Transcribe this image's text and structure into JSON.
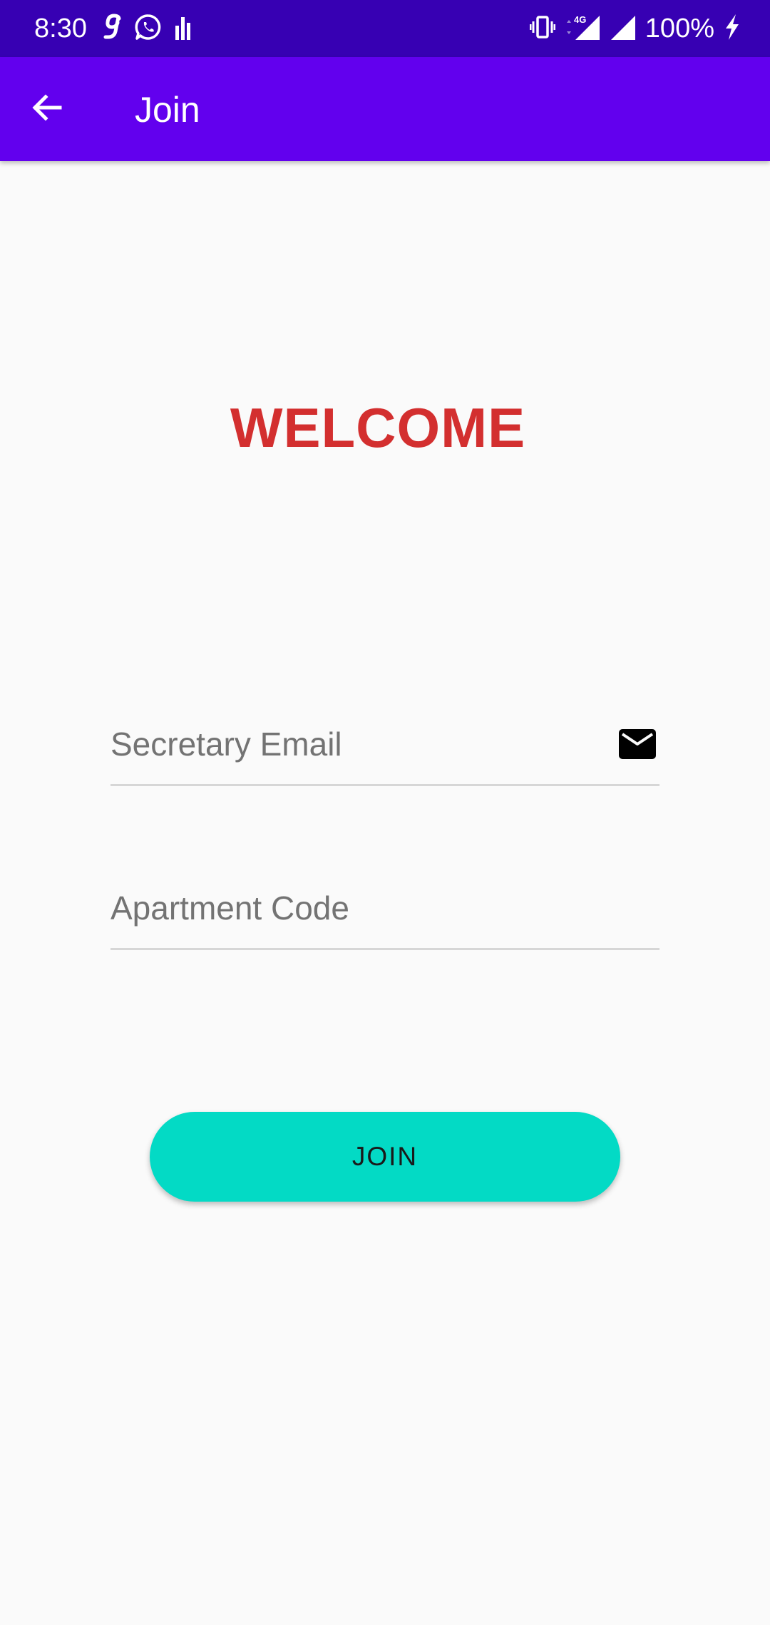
{
  "status_bar": {
    "time": "8:30",
    "battery": "100%",
    "network_type": "4G",
    "left_icons": [
      "g-icon",
      "whatsapp-icon",
      "bar-chart-icon"
    ],
    "right_icons": [
      "vibrate-icon",
      "signal-4g-icon",
      "signal-icon",
      "charging-icon"
    ],
    "background_color": "#3700b3"
  },
  "app_bar": {
    "title": "Join",
    "back_icon": "arrow-back-icon",
    "background_color": "#6200ee"
  },
  "main": {
    "welcome_text": "WELCOME",
    "welcome_color": "#d32f2f",
    "email_field": {
      "placeholder": "Secretary Email",
      "value": "",
      "icon": "mail-icon"
    },
    "code_field": {
      "placeholder": "Apartment Code",
      "value": ""
    },
    "join_button": {
      "label": "JOIN",
      "color": "#03dac5"
    }
  }
}
